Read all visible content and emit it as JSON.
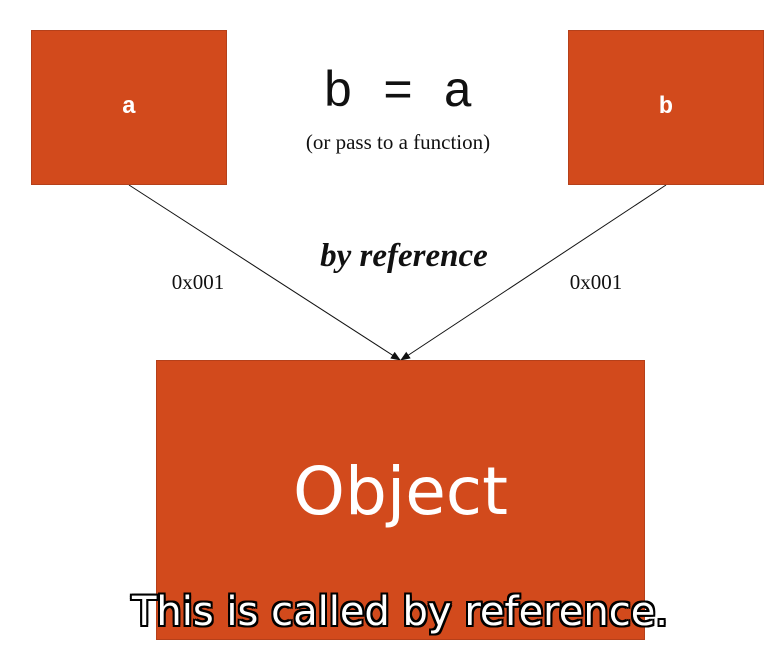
{
  "boxes": {
    "a_label": "a",
    "b_label": "b",
    "object_label": "Object"
  },
  "assignment": {
    "expression": "b = a",
    "note": "(or pass to a function)"
  },
  "arrow_label": "by reference",
  "addresses": {
    "left": "0x001",
    "right": "0x001"
  },
  "caption": "This is called by reference.",
  "colors": {
    "box_fill": "#d24a1c",
    "box_text": "#ffffff",
    "line": "#111111"
  }
}
